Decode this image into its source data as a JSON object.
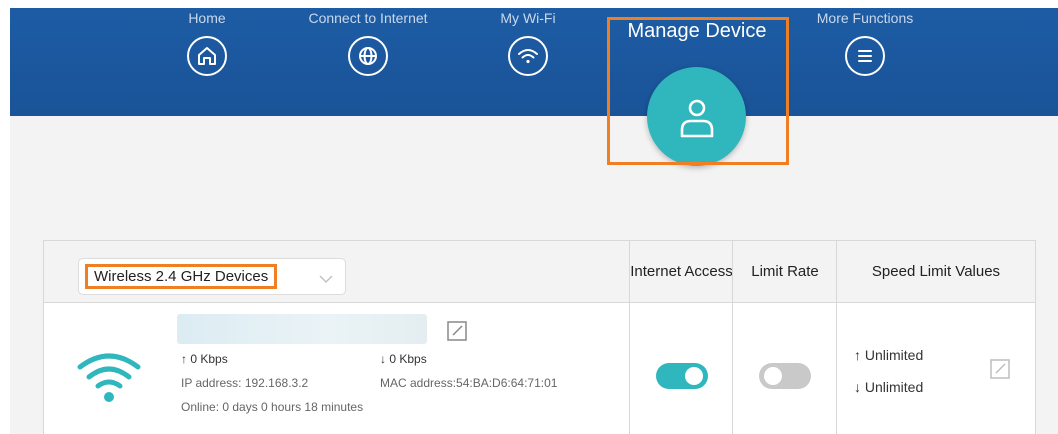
{
  "nav": {
    "items": [
      {
        "label": "Home",
        "icon": "home-icon"
      },
      {
        "label": "Connect to Internet",
        "icon": "globe-icon"
      },
      {
        "label": "My Wi-Fi",
        "icon": "wifi-icon"
      },
      {
        "label": "Manage Device",
        "icon": "user-icon",
        "active": true
      },
      {
        "label": "More Functions",
        "icon": "menu-icon"
      }
    ]
  },
  "table": {
    "device_filter": "Wireless 2.4 GHz Devices",
    "headers": {
      "internet_access": "Internet Access",
      "limit_rate": "Limit Rate",
      "speed_limit_values": "Speed Limit Values"
    },
    "device": {
      "upload_rate": "0 Kbps",
      "download_rate": "0 Kbps",
      "ip_address": "IP address: 192.168.3.2",
      "mac_address": "MAC address:54:BA:D6:64:71:01",
      "online": "Online: 0 days 0 hours 18 minutes",
      "internet_access_enabled": true,
      "limit_rate_enabled": false,
      "upload_limit": "Unlimited",
      "download_limit": "Unlimited"
    }
  },
  "colors": {
    "header_blue": "#1d5ca4",
    "accent_teal": "#2fb7bd",
    "highlight_orange": "#f07f23"
  }
}
